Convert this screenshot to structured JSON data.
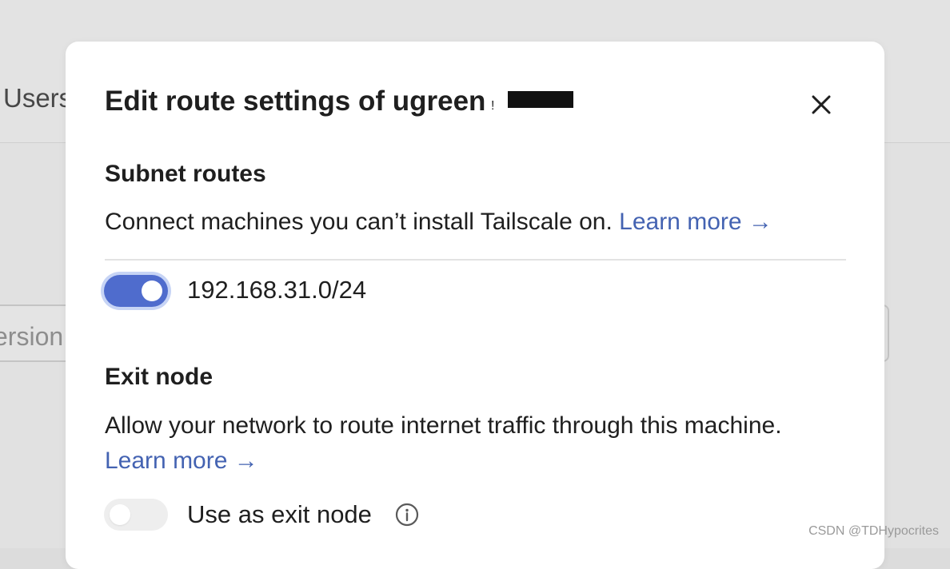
{
  "background": {
    "tab_label": "Users",
    "search_placeholder": "ersion"
  },
  "modal": {
    "title": "Edit route settings of ugreen",
    "title_fragment": "!",
    "close_icon": "close-icon"
  },
  "subnet": {
    "heading": "Subnet routes",
    "description": "Connect machines you can’t install Tailscale on.",
    "learn_more": "Learn more →",
    "routes": [
      {
        "cidr": "192.168.31.0/24",
        "enabled": true
      }
    ]
  },
  "exit_node": {
    "heading": "Exit node",
    "description": "Allow your network to route internet traffic through this machine.",
    "learn_more": "Learn more →",
    "toggle_label": "Use as exit node",
    "enabled": false,
    "info_icon": "info-icon"
  },
  "colors": {
    "accent": "#4f6ccd",
    "link": "#4463b2",
    "toggle_off": "#eeeeee",
    "overlay": "#dcdcdc"
  },
  "watermark": "CSDN @TDHypocrites"
}
